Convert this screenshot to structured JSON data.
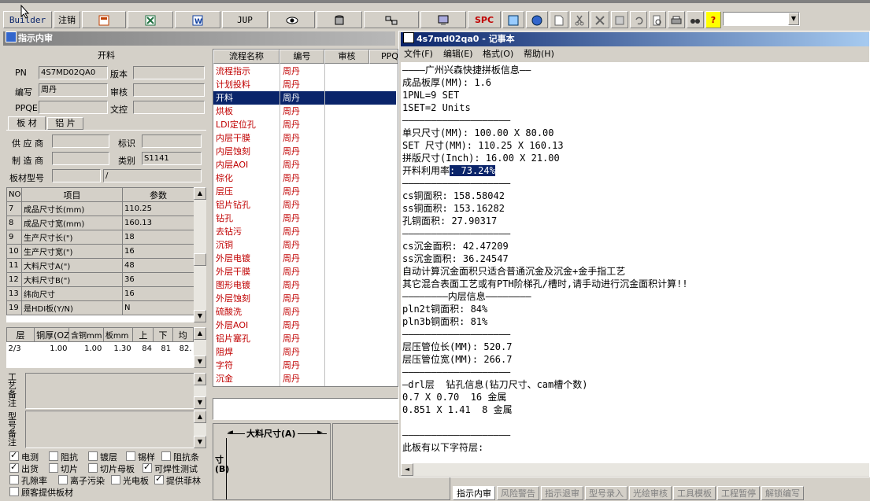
{
  "toolbar": {
    "builder": "Builder",
    "logout": "注销",
    "jup": "JUP",
    "spc": "SPC",
    "combo_value": ""
  },
  "left": {
    "title": "指示内审",
    "section": "开料",
    "pn_label": "PN",
    "pn_value": "4S7MD02QA0",
    "version_label": "版本",
    "version_value": "",
    "code_label": "编写",
    "code_value": "周丹",
    "review_label": "审核",
    "review_value": "",
    "ppqe_label": "PPQE",
    "ppqe_value": "",
    "doccontrol_label": "文控",
    "doccontrol_value": "",
    "tabs": [
      "板 材",
      "铝 片"
    ],
    "supplier_label": "供 应 商",
    "supplier_value": "",
    "mark_label": "标识",
    "mark_value": "",
    "maker_label": "制 造 商",
    "maker_value": "",
    "type_label": "类别",
    "type_value": "S1141",
    "model_label": "板材型号",
    "model_value": "",
    "model_value2": "/",
    "params_header": {
      "no": "NO",
      "item": "项目",
      "value": "参数"
    },
    "params": [
      {
        "no": "7",
        "item": "成品尺寸长(mm)",
        "value": "110.25"
      },
      {
        "no": "8",
        "item": "成品尺寸宽(mm)",
        "value": "160.13"
      },
      {
        "no": "9",
        "item": "生产尺寸长(\")",
        "value": "18"
      },
      {
        "no": "10",
        "item": "生产尺寸宽(\")",
        "value": "16"
      },
      {
        "no": "11",
        "item": "大料尺寸A(\")",
        "value": "48"
      },
      {
        "no": "12",
        "item": "大料尺寸B(\")",
        "value": "36"
      },
      {
        "no": "13",
        "item": "纬向尺寸",
        "value": "16"
      },
      {
        "no": "19",
        "item": "是HDI板(Y/N)",
        "value": "N"
      }
    ],
    "layer_header": [
      "层",
      "铜厚(OZ)",
      "含铜mm",
      "板mm",
      "上",
      "下",
      "均"
    ],
    "layer_row": [
      "2/3",
      "1.00",
      "1.00",
      "1.30",
      "84",
      "81",
      "82."
    ],
    "process_note_label": "工艺备注",
    "model_note_label": "型号备注",
    "checkboxes": [
      {
        "label": "电测",
        "checked": true
      },
      {
        "label": "阻抗",
        "checked": false
      },
      {
        "label": "镀层",
        "checked": false
      },
      {
        "label": "锡样",
        "checked": false
      },
      {
        "label": "阻抗条",
        "checked": false
      },
      {
        "label": "出货",
        "checked": true
      },
      {
        "label": "切片",
        "checked": false
      },
      {
        "label": "切片母板",
        "checked": false
      },
      {
        "label": "可焊性测试",
        "checked": true
      },
      {
        "label": "孔隙率",
        "checked": false
      },
      {
        "label": "离子污染",
        "checked": false
      },
      {
        "label": "光电板",
        "checked": false
      },
      {
        "label": "提供菲林",
        "checked": true
      },
      {
        "label": "顾客提供板材",
        "checked": false
      }
    ]
  },
  "flow": {
    "headers": [
      "流程名称",
      "编号",
      "审核",
      "PPQ"
    ],
    "rows": [
      {
        "name": "流程指示",
        "code": "周丹"
      },
      {
        "name": "计划投料",
        "code": "周丹"
      },
      {
        "name": "开料",
        "code": "周丹"
      },
      {
        "name": "烘板",
        "code": "周丹"
      },
      {
        "name": "LDI定位孔",
        "code": "周丹"
      },
      {
        "name": "内层干膜",
        "code": "周丹"
      },
      {
        "name": "内层蚀刻",
        "code": "周丹"
      },
      {
        "name": "内层AOI",
        "code": "周丹"
      },
      {
        "name": "棕化",
        "code": "周丹"
      },
      {
        "name": "层压",
        "code": "周丹"
      },
      {
        "name": "铝片钻孔",
        "code": "周丹"
      },
      {
        "name": "钻孔",
        "code": "周丹"
      },
      {
        "name": "去钻污",
        "code": "周丹"
      },
      {
        "name": "沉铜",
        "code": "周丹"
      },
      {
        "name": "外层电镀",
        "code": "周丹"
      },
      {
        "name": "外层干膜",
        "code": "周丹"
      },
      {
        "name": "图形电镀",
        "code": "周丹"
      },
      {
        "name": "外层蚀刻",
        "code": "周丹"
      },
      {
        "name": "硫酸洗",
        "code": "周丹"
      },
      {
        "name": "外层AOI",
        "code": "周丹"
      },
      {
        "name": "铝片塞孔",
        "code": "周丹"
      },
      {
        "name": "阻焊",
        "code": "周丹"
      },
      {
        "name": "字符",
        "code": "周丹"
      },
      {
        "name": "沉金",
        "code": "周丹"
      }
    ],
    "selected_index": 2,
    "dim_label": "大料尺寸(A)",
    "dim_label_v": "寸(B)"
  },
  "notepad": {
    "title": "4s7md02qa0 - 记事本",
    "menu": [
      "文件(F)",
      "编辑(E)",
      "格式(O)",
      "帮助(H)"
    ],
    "lines_before_hl": "————广州兴森快捷拼板信息——\n成品板厚(MM): 1.6\n1PNL=9 SET\n1SET=2 Units\n———————————————————\n单只尺寸(MM): 100.00 X 80.00\nSET 尺寸(MM): 110.25 X 160.13\n拼版尺寸(Inch): 16.00 X 21.00\n开料利用率",
    "highlight": ": 73.24%",
    "lines_after_hl": "\n———————————————————\ncs铜面积: 158.58042\nss铜面积: 153.16282\n孔铜面积: 27.90317\n———————————————————\ncs沉金面积: 42.47209\nss沉金面积: 36.24547\n自动计算沉金面积只适合普通沉金及沉金+金手指工艺\n其它混合表面工艺或有PTH阶梯孔/槽时,请手动进行沉金面积计算!!\n————————内层信息————————\npln2t铜面积: 84%\npln3b铜面积: 81%\n———————————————————\n层压管位长(MM): 520.7\n层压管位宽(MM): 266.7\n———————————————————\n—drl层  钻孔信息(钻刀尺寸、cam槽个数)\n0.7 X 0.70  16 金属\n0.851 X 1.41  8 金属\n\n———————————————————\n此板有以下字符层:"
  },
  "bottom_tabs": [
    "指示内审",
    "风险警告",
    "指示退审",
    "型号录入",
    "光绘审核",
    "工具模板",
    "工程暂停",
    "解锁编写"
  ],
  "bottom_active": 0
}
